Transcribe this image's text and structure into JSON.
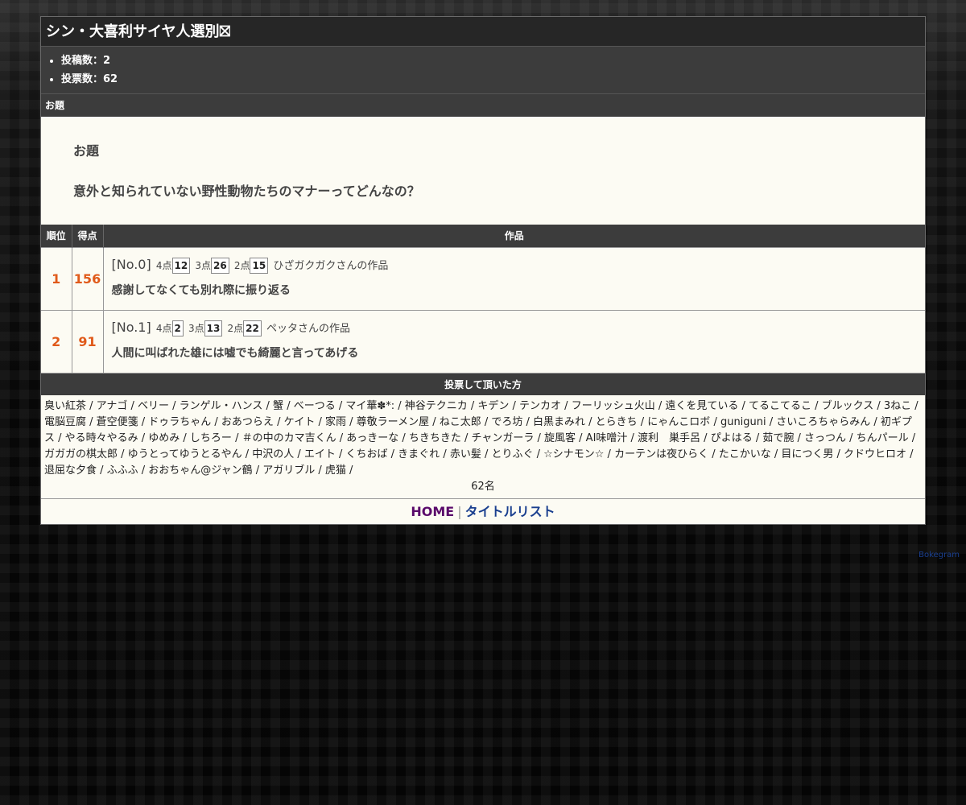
{
  "page_title": "シン・大喜利サイヤ人選別⛝",
  "stats": [
    {
      "label": "投稿数：2"
    },
    {
      "label": "投票数：62"
    }
  ],
  "odai_section": {
    "header": "お題",
    "label": "お題",
    "text": "意外と知られていない野性動物たちのマナーってどんなの？"
  },
  "table_headers": {
    "rank": "順位",
    "score": "得点",
    "work": "作品"
  },
  "works": [
    {
      "rank": "1",
      "score": "156",
      "no": "[No.0]",
      "p4_label": "4点",
      "p4": "12",
      "p3_label": "3点",
      "p3": "26",
      "p2_label": "2点",
      "p2": "15",
      "author": "ひざガクガクさんの作品",
      "title": "感謝してなくても別れ際に振り返る"
    },
    {
      "rank": "2",
      "score": "91",
      "no": "[No.1]",
      "p4_label": "4点",
      "p4": "2",
      "p3_label": "3点",
      "p3": "13",
      "p2_label": "2点",
      "p2": "22",
      "author": "ペッタさんの作品",
      "title": "人間に叫ばれた雄には嘘でも綺麗と言ってあげる"
    }
  ],
  "voters_header": "投票して頂いた方",
  "voters_text": "臭い紅茶 / アナゴ / ベリー / ランゲル・ハンス / 蟹 / べーつる / マイ華✽*: / 神谷テクニカ / キデン / テンカオ / フーリッシュ火山 / 遠くを見ている / てるこてるこ / ブルックス / 3ねこ / 電脳豆腐 / 蒼空便箋 / ドゥラちゃん / おあつらえ / ケイト / 家雨 / 尊敬ラーメン屋 / ねこ太郎 / でろ坊 / 白黒まみれ / とらきち / にゃんこロボ / guniguni / さいころちゃらみん / 初ギプス / やる時々やるみ / ゆめみ / しちろー / ＃の中のカマ吉くん / あっきーな / ちきちきた / チャンガーラ / 旋風客 / AI味噌汁 / 渡利　巣手呂 / ぴよはる / 茹で腕 / さっつん / ちんパール / ガガガの棋太郎 / ゆうとってゆうとるやん / 中沢の人 / エイト / くちおば / きまぐれ / 赤い髪 / とりふぐ / ☆シナモン☆ / カーテンは夜ひらく / たこかいな / 目につく男 / クドウヒロオ / 退屈な夕食 / ふふふ / おおちゃん@ジャン鶴 / アガリブル / 虎猫 /",
  "voters_count": "62名",
  "nav": {
    "home": "HOME",
    "separator": "|",
    "title_list": "タイトルリスト"
  },
  "credit": "Bokegram",
  "colors": {
    "score": "#e05a1a",
    "home_link": "#5a0a6b",
    "list_link": "#1a3f8f",
    "bar": "#3c3c3c"
  }
}
